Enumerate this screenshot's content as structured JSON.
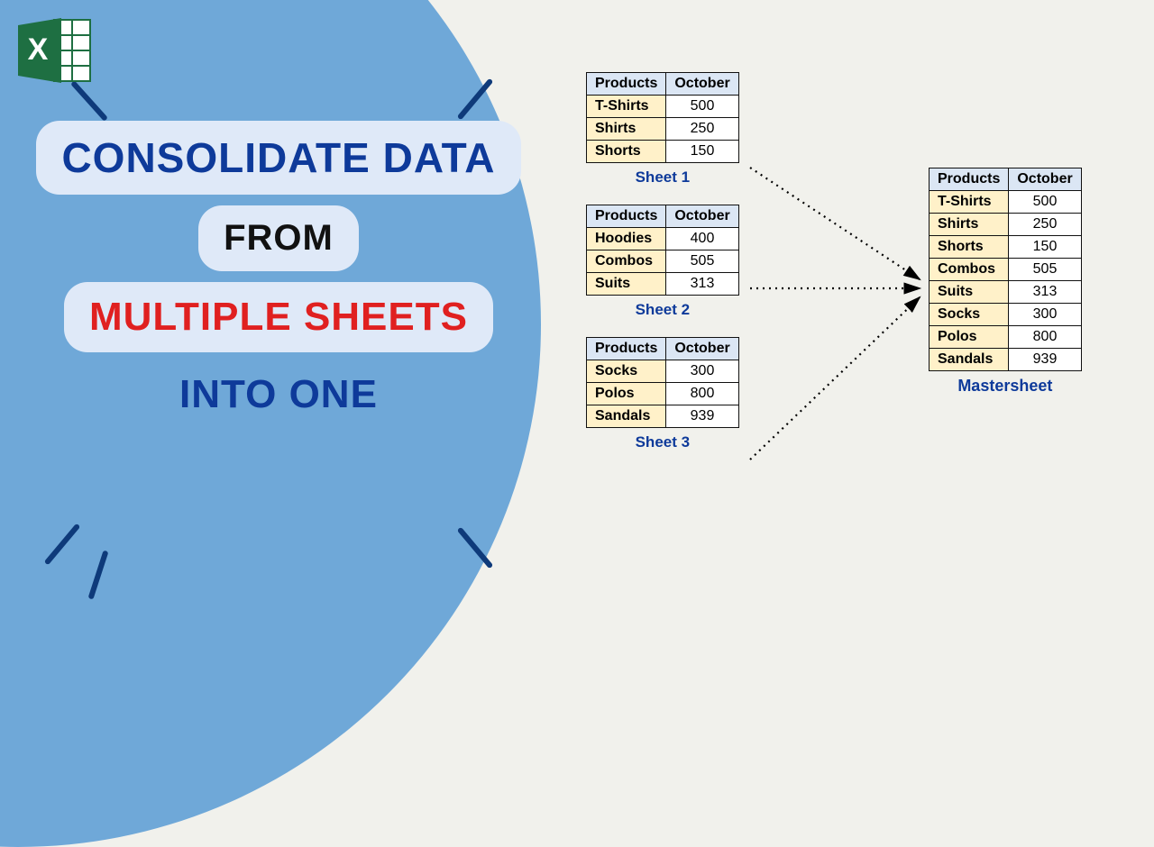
{
  "title": {
    "line1": "CONSOLIDATE DATA",
    "line2": "FROM",
    "line3": "MULTIPLE SHEETS",
    "line4": "INTO ONE"
  },
  "table_headers": {
    "col1": "Products",
    "col2": "October"
  },
  "sheets": [
    {
      "label": "Sheet 1",
      "rows": [
        {
          "product": "T-Shirts",
          "value": "500"
        },
        {
          "product": "Shirts",
          "value": "250"
        },
        {
          "product": "Shorts",
          "value": "150"
        }
      ]
    },
    {
      "label": "Sheet 2",
      "rows": [
        {
          "product": "Hoodies",
          "value": "400"
        },
        {
          "product": "Combos",
          "value": "505"
        },
        {
          "product": "Suits",
          "value": "313"
        }
      ]
    },
    {
      "label": "Sheet 3",
      "rows": [
        {
          "product": "Socks",
          "value": "300"
        },
        {
          "product": "Polos",
          "value": "800"
        },
        {
          "product": "Sandals",
          "value": "939"
        }
      ]
    }
  ],
  "master": {
    "label": "Mastersheet",
    "rows": [
      {
        "product": "T-Shirts",
        "value": "500"
      },
      {
        "product": "Shirts",
        "value": "250"
      },
      {
        "product": "Shorts",
        "value": "150"
      },
      {
        "product": "Combos",
        "value": "505"
      },
      {
        "product": "Suits",
        "value": "313"
      },
      {
        "product": "Socks",
        "value": "300"
      },
      {
        "product": "Polos",
        "value": "800"
      },
      {
        "product": "Sandals",
        "value": "939"
      }
    ]
  }
}
